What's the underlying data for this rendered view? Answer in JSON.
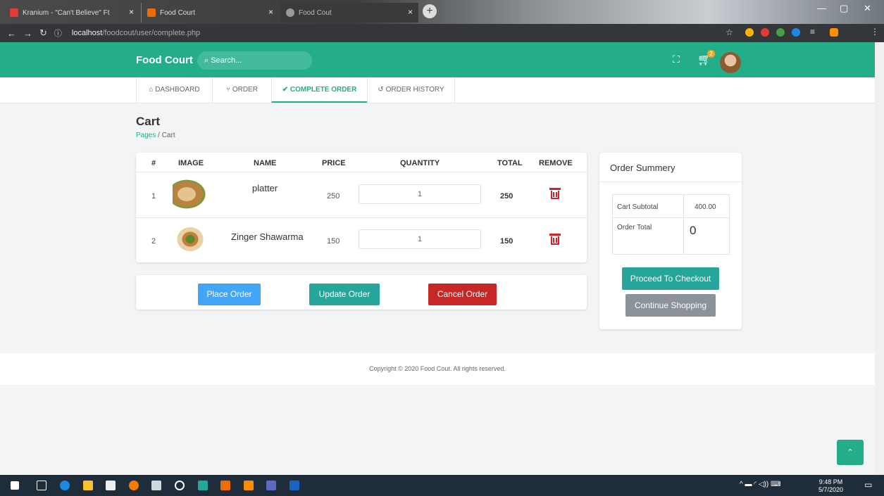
{
  "browser": {
    "tabs": [
      {
        "title": "Kranium - \"Can't Believe\" Ft"
      },
      {
        "title": "Food Court"
      },
      {
        "title": "Food Cout"
      }
    ],
    "url_host": "localhost",
    "url_path": "/foodcout/user/complete.php"
  },
  "header": {
    "brand": "Food Court",
    "search_placeholder": "Search...",
    "cart_count": "2"
  },
  "nav": {
    "tabs": [
      {
        "label": "DASHBOARD",
        "icon": "home-icon"
      },
      {
        "label": "ORDER",
        "icon": "utensils-icon"
      },
      {
        "label": "COMPLETE ORDER",
        "icon": "check-icon",
        "active": true
      },
      {
        "label": "ORDER HISTORY",
        "icon": "history-icon"
      }
    ]
  },
  "page": {
    "title": "Cart",
    "breadcrumb_root": "Pages",
    "breadcrumb_sep": "/",
    "breadcrumb_current": "Cart"
  },
  "cart": {
    "columns": [
      "#",
      "IMAGE",
      "NAME",
      "PRICE",
      "QUANTITY",
      "TOTAL",
      "REMOVE"
    ],
    "rows": [
      {
        "num": "1",
        "name": "platter",
        "price": "250",
        "qty": "1",
        "total": "250"
      },
      {
        "num": "2",
        "name": "Zinger Shawarma",
        "price": "150",
        "qty": "1",
        "total": "150"
      }
    ]
  },
  "actions": {
    "place": "Place Order",
    "update": "Update Order",
    "cancel": "Cancel Order"
  },
  "summary": {
    "title": "Order Summery",
    "subtotal_label": "Cart Subtotal",
    "subtotal_value": "400.00",
    "total_label": "Order Total",
    "total_value": "0",
    "checkout": "Proceed To Checkout",
    "continue": "Continue Shopping"
  },
  "footer": {
    "text": "Copyright © 2020 Food Cout. All rights reserved."
  },
  "taskbar": {
    "time": "9:48 PM",
    "date": "5/7/2020"
  },
  "colors": {
    "brand": "#24ad89",
    "place": "#42a5f5",
    "update": "#26a69a",
    "cancel": "#c62828",
    "continue": "#8b9298"
  }
}
